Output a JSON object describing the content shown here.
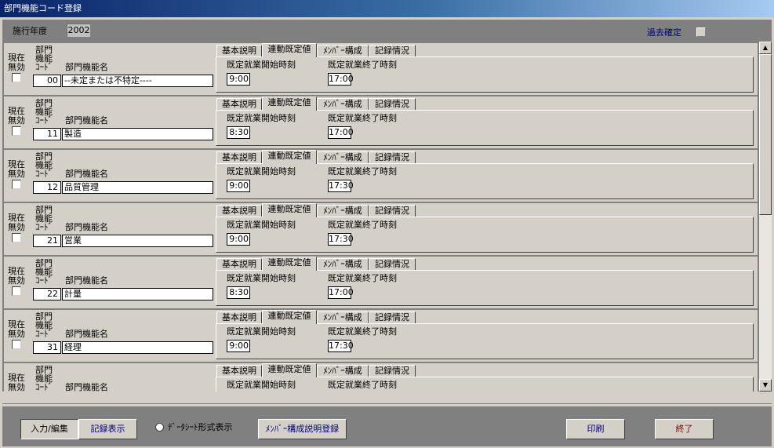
{
  "window": {
    "title": "部門機能コード登録"
  },
  "header": {
    "year_label": "施行年度",
    "year_value": "2002",
    "past_confirm_label": "過去確定"
  },
  "columns": {
    "invalid_line1": "現在",
    "invalid_line2": "無効",
    "code_line1": "部門",
    "code_line2": "機能",
    "code_line3": "ｺｰﾄﾞ",
    "name": "部門機能名",
    "start_time": "既定就業開始時刻",
    "end_time": "既定就業終了時刻"
  },
  "tabs": [
    "基本説明",
    "連動既定値",
    "ﾒﾝﾊﾞｰ構成",
    "記録情況"
  ],
  "records": [
    {
      "code": "00",
      "name": "--未定または不特定----",
      "start": "9:00",
      "end": "17:00"
    },
    {
      "code": "11",
      "name": "製造",
      "start": "8:30",
      "end": "17:00"
    },
    {
      "code": "12",
      "name": "品質管理",
      "start": "9:00",
      "end": "17:30"
    },
    {
      "code": "21",
      "name": "営業",
      "start": "9:00",
      "end": "17:30"
    },
    {
      "code": "22",
      "name": "計量",
      "start": "8:30",
      "end": "17:00"
    },
    {
      "code": "31",
      "name": "経理",
      "start": "9:00",
      "end": "17:30"
    }
  ],
  "partial_record": {},
  "footer": {
    "input_edit": "入力/編集",
    "record_view": "記録表示",
    "datasheet_view": "ﾃﾞｰﾀｼｰﾄ形式表示",
    "member_register": "ﾒﾝﾊﾞｰ構成説明登録",
    "print": "印刷",
    "exit": "終了"
  },
  "colors": {
    "exit_text": "#800000",
    "accent_text": "#000080"
  }
}
